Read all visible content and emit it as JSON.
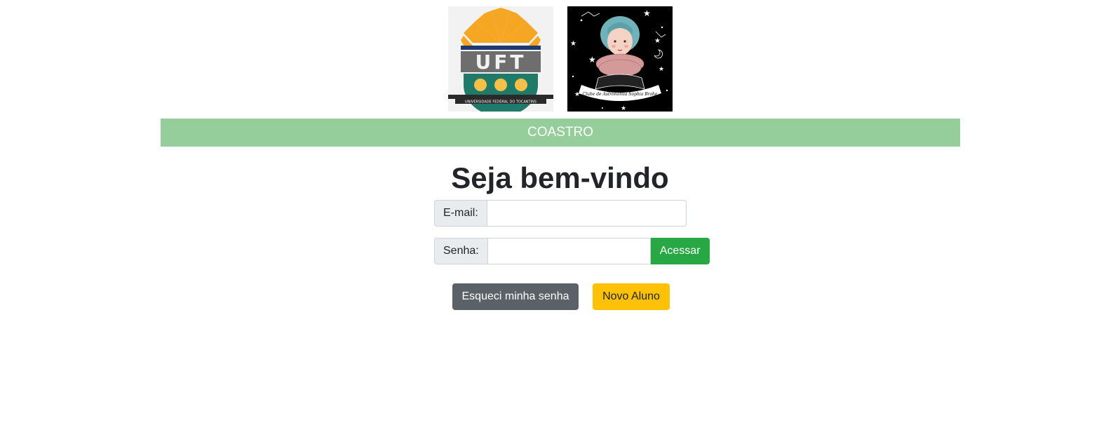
{
  "logos": {
    "uft_icon": "uft-university-logo",
    "uft_caption": "UNIVERSIDADE FEDERAL DO TOCANTINS",
    "uft_letters": "UFT",
    "club_icon": "astronomy-club-logo",
    "club_caption": "Clube de Astronomia Sophia Brahe"
  },
  "banner": {
    "title": "COASTRO",
    "color": "#95cd9b"
  },
  "welcome": "Seja bem-vindo",
  "form": {
    "email_label": "E-mail:",
    "email_value": "",
    "senha_label": "Senha:",
    "senha_value": "",
    "access_button": "Acessar"
  },
  "actions": {
    "forgot_button": "Esqueci minha senha",
    "new_student_button": "Novo Aluno"
  },
  "colors": {
    "success": "#28a745",
    "secondary": "#5a6268",
    "warning": "#ffc107"
  }
}
